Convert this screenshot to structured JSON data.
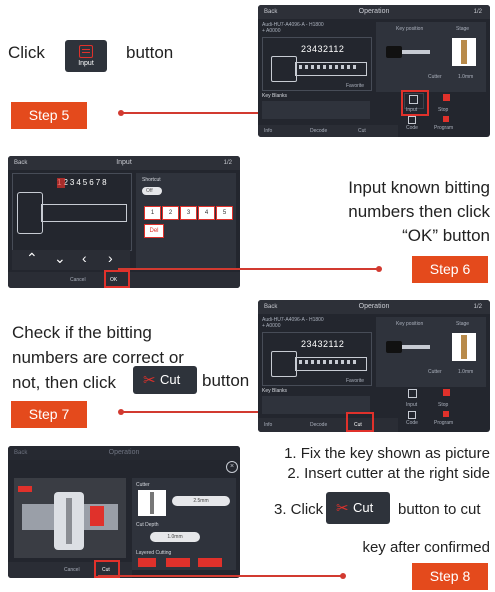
{
  "step5": {
    "click_text": "Click",
    "button_label": "Input",
    "after_text": "button",
    "badge": "Step 5"
  },
  "step6": {
    "instruction": [
      "Input known bitting",
      "numbers then click",
      "“OK” button"
    ],
    "badge": "Step 6"
  },
  "step7": {
    "instruction_line1": "Check if the bitting",
    "instruction_line2": "numbers are correct or",
    "instruction_line3_pre": "not, then click",
    "button_label": "Cut",
    "instruction_line3_post": "button",
    "badge": "Step 7"
  },
  "step8": {
    "line1": "1. Fix the key shown as picture",
    "line2": "2. Insert cutter at the right side",
    "line3_pre": "3. Click",
    "button_label": "Cut",
    "line3_post": "button to cut",
    "line4": "key after confirmed",
    "badge": "Step 8"
  },
  "op_screen": {
    "back": "Back",
    "title": "Operation",
    "subtitle_a": "Audi-HU7-A4096-A - H1800",
    "subtitle_b": "+ A0000",
    "bitting": "23432112",
    "favorite": "Favorite",
    "key_blanks": "Key Blanks",
    "key_position": "Key position",
    "step_title": "Stage",
    "cut_label": "Cut",
    "decode_label": "Decode",
    "info_label": "Info",
    "input_label": "Input",
    "code_label": "Code",
    "stop_label": "Stop",
    "program_label": "Program",
    "cutter_label": "Cutter",
    "clamp_label": "1.0mm"
  },
  "input_screen": {
    "back": "Back",
    "title": "Input",
    "top_right": "1/2",
    "digits": "12345678",
    "shortcut": "Shortcut",
    "toggle": "Off",
    "keys": [
      "1",
      "2",
      "3",
      "4",
      "5"
    ],
    "del": "Del",
    "cancel": "Cancel",
    "ok": "OK"
  },
  "cut_screen": {
    "back": "Back",
    "title": "Operation",
    "cutter": "Cutter",
    "cutter_value": "2.5mm",
    "cut_depth": "Cut Depth",
    "depth_value": "1.0mm",
    "layered_cutting": "Layered Cutting",
    "cancel": "Cancel",
    "cut": "Cut"
  },
  "colors": {
    "accent": "#e44a1c",
    "highlight": "#e0312b",
    "screen_bg": "#23262e"
  }
}
